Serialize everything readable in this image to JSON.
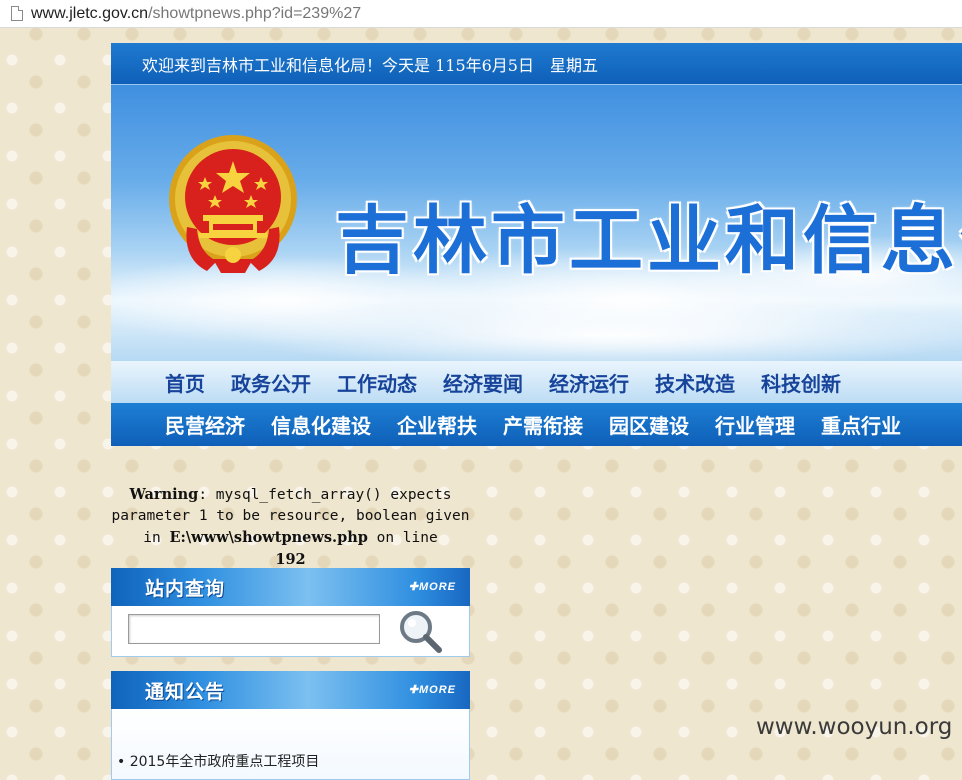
{
  "browser": {
    "url_domain": "www.jletc.gov.cn",
    "url_path": "/showtpnews.php?id=239%27"
  },
  "header": {
    "welcome": "欢迎来到吉林市工业和信息化局！今天是 115年6月5日　星期五",
    "banner_title": "吉林市工业和信息化"
  },
  "nav_top": [
    "首页",
    "政务公开",
    "工作动态",
    "经济要闻",
    "经济运行",
    "技术改造",
    "科技创新"
  ],
  "nav_bottom": [
    "民营经济",
    "信息化建设",
    "企业帮扶",
    "产需衔接",
    "园区建设",
    "行业管理",
    "重点行业"
  ],
  "error": {
    "label": "Warning",
    "message": ": mysql_fetch_array() expects parameter 1 to be resource, boolean given in ",
    "file": "E:\\www\\showtpnews.php",
    "on_line": " on line ",
    "line": "192"
  },
  "search_panel": {
    "title": "站内查询",
    "more": "MORE"
  },
  "notice_panel": {
    "title": "通知公告",
    "more": "MORE",
    "items": [
      "• 2015年全市政府重点工程项目"
    ]
  },
  "watermark": "www.wooyun.org",
  "icons": {
    "search": "magnifier-icon",
    "emblem": "national-emblem"
  },
  "colors": {
    "nav_dark": "#0f5fb8",
    "nav_light": "#bcdcf4",
    "nav_light_text": "#17449a"
  }
}
